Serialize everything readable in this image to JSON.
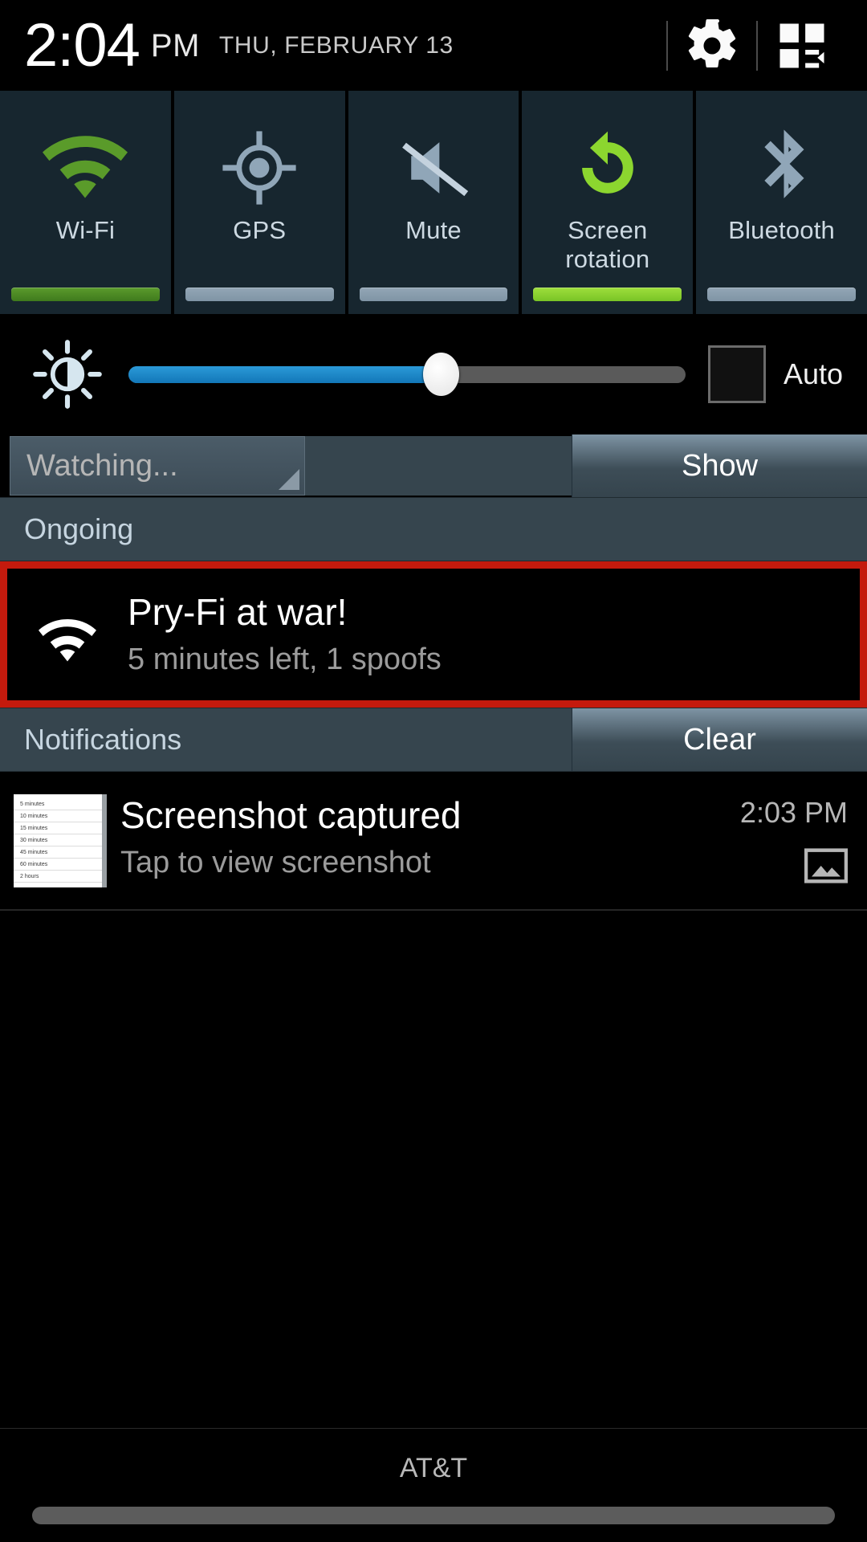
{
  "statusbar": {
    "time": "2:04",
    "ampm": "PM",
    "date": "THU, FEBRUARY 13",
    "settings_icon": "gear-icon",
    "edit_icon": "quick-settings-grid-icon"
  },
  "quick_settings": {
    "tiles": [
      {
        "label": "Wi-Fi",
        "icon": "wifi-icon",
        "state": "on-dim"
      },
      {
        "label": "GPS",
        "icon": "gps-crosshair-icon",
        "state": "off"
      },
      {
        "label": "Mute",
        "icon": "mute-speaker-icon",
        "state": "off"
      },
      {
        "label": "Screen\nrotation",
        "icon": "screen-rotation-icon",
        "state": "on-bright"
      },
      {
        "label": "Bluetooth",
        "icon": "bluetooth-icon",
        "state": "off"
      }
    ],
    "colors": {
      "tile_bg": "#17262f",
      "on_dim": "#4f8a24",
      "on_bright": "#8cd62f",
      "off": "#8a9dae"
    }
  },
  "brightness": {
    "icon": "brightness-sun-icon",
    "value_percent": 56,
    "auto_label": "Auto",
    "auto_checked": false,
    "fill_color": "#1f8ecd"
  },
  "spinner_row": {
    "spinner_label": "Watching...",
    "show_button": "Show"
  },
  "ongoing": {
    "header": "Ongoing",
    "notification": {
      "icon": "wifi-icon",
      "title": "Pry-Fi at war!",
      "subtitle": "5 minutes left, 1 spoofs",
      "highlight_color": "#c41a0d"
    }
  },
  "notifications_section": {
    "header": "Notifications",
    "clear_button": "Clear",
    "items": [
      {
        "title": "Screenshot captured",
        "subtitle": "Tap to view screenshot",
        "time": "2:03 PM",
        "small_icon": "image-icon",
        "thumbnail_lines": [
          "5 minutes",
          "10 minutes",
          "15 minutes",
          "30 minutes",
          "45 minutes",
          "60 minutes",
          "2 hours"
        ]
      }
    ]
  },
  "footer": {
    "carrier": "AT&T"
  }
}
